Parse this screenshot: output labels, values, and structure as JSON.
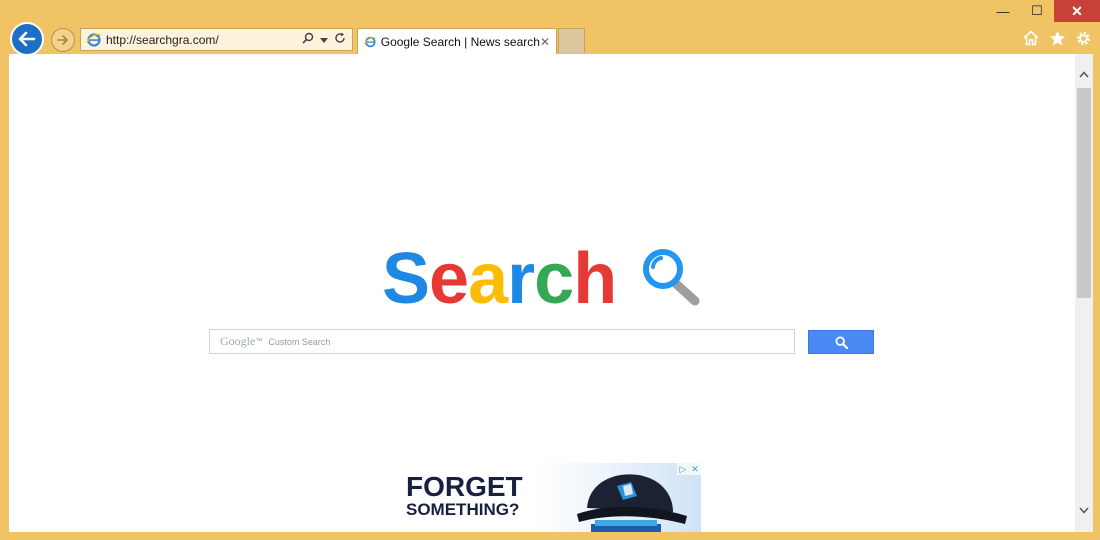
{
  "window": {
    "minimize_label": "—",
    "maximize_label": "☐",
    "close_label": "✕"
  },
  "navigation": {
    "url": "http://searchgra.com/",
    "search_icon": "magnifier-icon",
    "dropdown_icon": "chevron-down-icon",
    "refresh_icon": "refresh-icon"
  },
  "tabs": [
    {
      "title": "Google Search | News search",
      "close": "✕"
    }
  ],
  "toolbar_icons": [
    "home-icon",
    "star-icon",
    "gear-icon"
  ],
  "page": {
    "logo_letters": [
      {
        "char": "S",
        "color": "#1e88e5"
      },
      {
        "char": "e",
        "color": "#e53935"
      },
      {
        "char": "a",
        "color": "#fbbc05"
      },
      {
        "char": "r",
        "color": "#1e88e5"
      },
      {
        "char": "c",
        "color": "#34a853"
      },
      {
        "char": "h",
        "color": "#e53935"
      }
    ],
    "search": {
      "brand": "Google",
      "tm": "™",
      "placeholder": "Custom Search",
      "button_icon": "search-icon"
    },
    "ad": {
      "line1": "FORGET",
      "line2": "SOMETHING?"
    }
  },
  "colors": {
    "frame": "#f0c465",
    "back_button": "#1e6fc4",
    "close_button": "#c7403a",
    "search_button": "#4a8af4"
  }
}
